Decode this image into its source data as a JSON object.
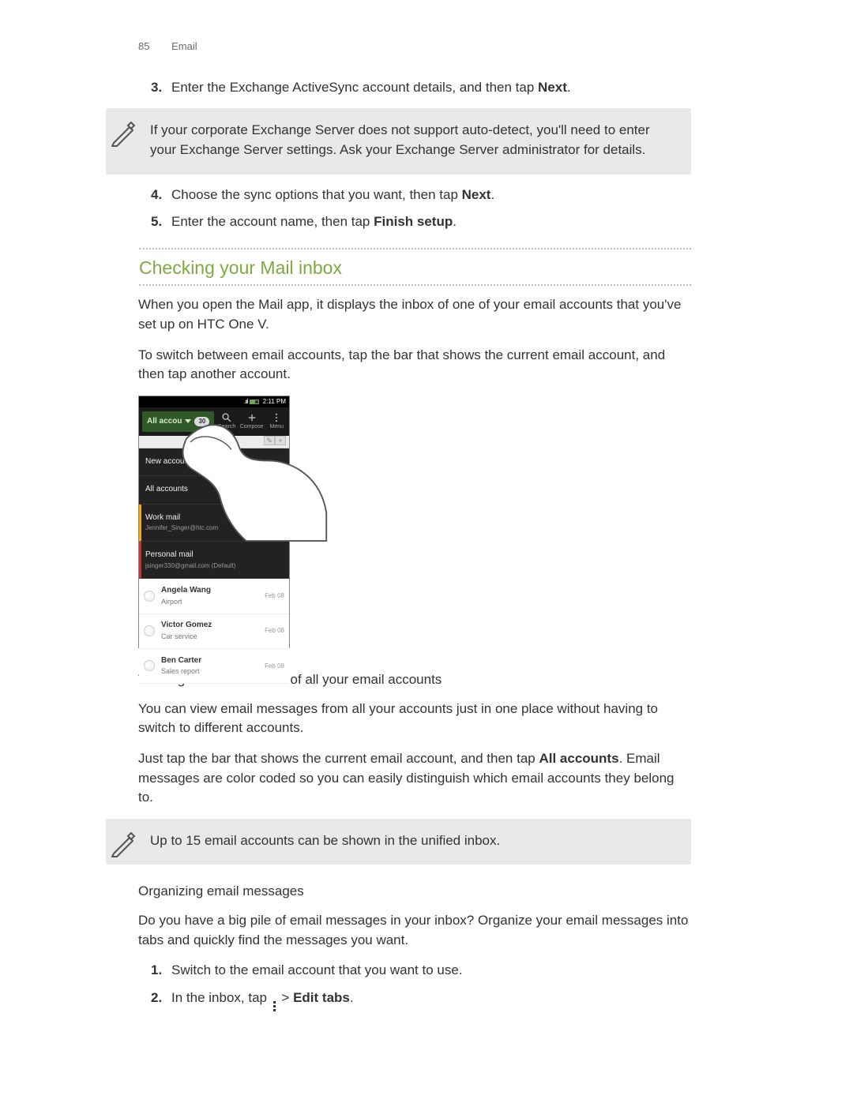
{
  "header": {
    "page_number": "85",
    "section": "Email"
  },
  "steps_a": [
    {
      "n": "3.",
      "pre": "Enter the Exchange ActiveSync account details, and then tap ",
      "bold": "Next",
      "post": "."
    }
  ],
  "note_a": "If your corporate Exchange Server does not support auto-detect, you'll need to enter your Exchange Server settings. Ask your Exchange Server administrator for details.",
  "steps_b": [
    {
      "n": "4.",
      "pre": "Choose the sync options that you want, then tap ",
      "bold": "Next",
      "post": "."
    },
    {
      "n": "5.",
      "pre": "Enter the account name, then tap ",
      "bold": "Finish setup",
      "post": "."
    }
  ],
  "section_heading": "Checking your Mail inbox",
  "para1": "When you open the Mail app, it displays the inbox of one of your email accounts that you've set up on HTC One V.",
  "para2": "To switch between email accounts, tap the bar that shows the current email account, and then tap another account.",
  "screenshot": {
    "status_time": "2:11 PM",
    "dropdown_label": "All accou",
    "badge": "30",
    "btn_search": "Search",
    "btn_compose": "Compose",
    "btn_menu": "Menu",
    "menu": {
      "new_account": "New account",
      "all_accounts": "All accounts",
      "work_title": "Work mail",
      "work_sub": "Jennifer_Singer@htc.com",
      "personal_title": "Personal mail",
      "personal_sub": "jsinger330@gmail.com (Default)"
    },
    "rows": [
      {
        "name": "Angela Wang",
        "subject": "Airport",
        "date": "Feb 08"
      },
      {
        "name": "Victor Gomez",
        "subject": "Car service",
        "date": "Feb 08"
      },
      {
        "name": "Ben Carter",
        "subject": "Sales report",
        "date": "Feb 08"
      }
    ]
  },
  "subhead_unified": "Viewing the unified inbox of all your email accounts",
  "para_unified1": "You can view email messages from all your accounts just in one place without having to switch to different accounts.",
  "para_unified2_pre": "Just tap the bar that shows the current email account, and then tap ",
  "para_unified2_bold": "All accounts",
  "para_unified2_post": ". Email messages are color coded so you can easily distinguish which email accounts they belong to.",
  "note_b": "Up to 15 email accounts can be shown in the unified inbox.",
  "subhead_org": "Organizing email messages",
  "para_org": "Do you have a big pile of email messages in your inbox? Organize your email messages into tabs and quickly find the messages you want.",
  "steps_c": [
    {
      "n": "1.",
      "text": "Switch to the email account that you want to use."
    },
    {
      "n": "2.",
      "pre": "In the inbox, tap ",
      "post_sep": " > ",
      "bold": "Edit tabs",
      "post": "."
    }
  ]
}
